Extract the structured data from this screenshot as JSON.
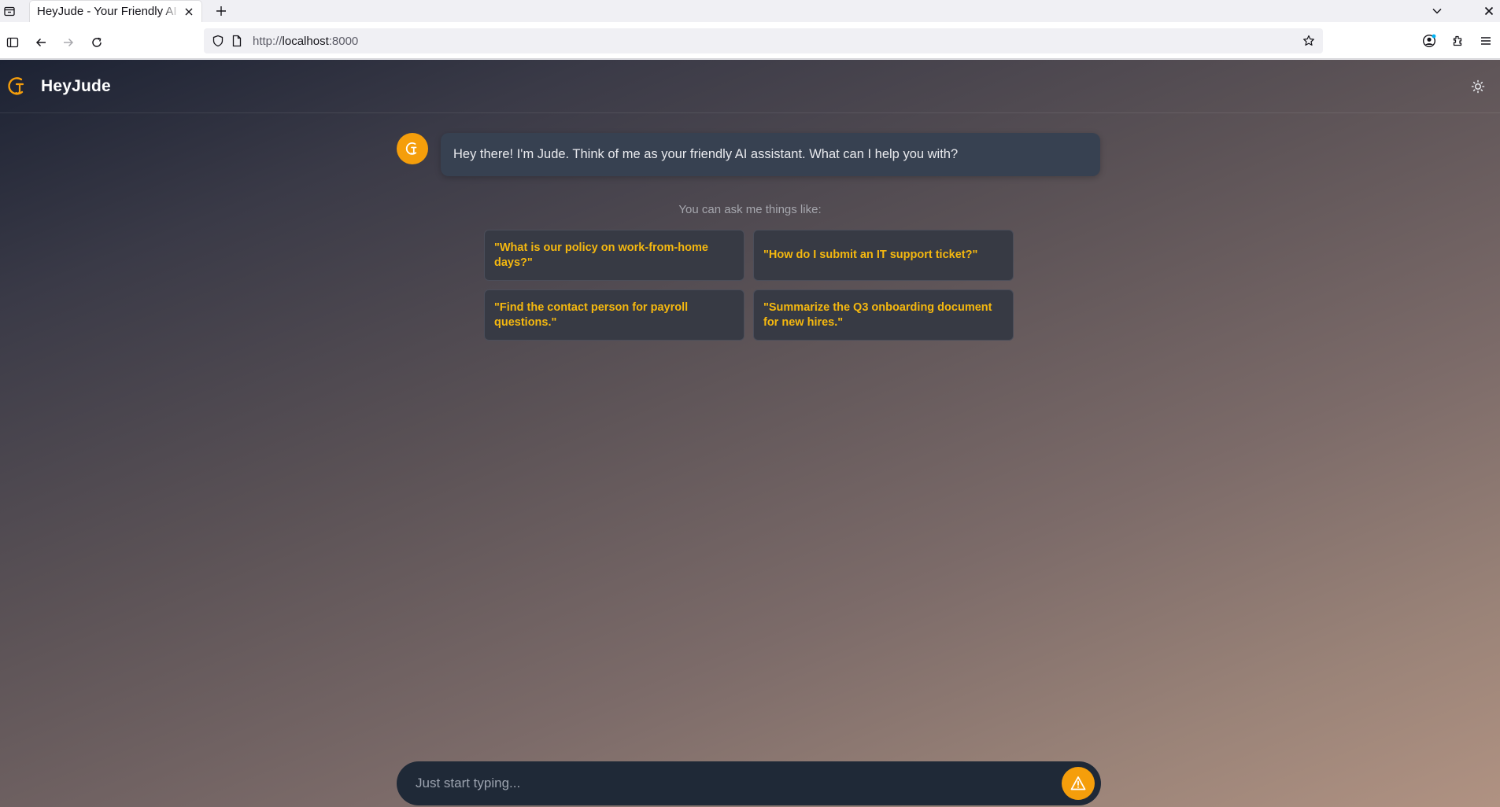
{
  "browser": {
    "tab_title": "HeyJude - Your Friendly AI",
    "url_prefix": "http://",
    "url_host": "localhost",
    "url_suffix": ":8000",
    "icons": {
      "tab_list": "tab-list-icon",
      "close_tab": "close-icon",
      "new_tab": "plus-icon",
      "list_all_tabs": "chevron-down-icon",
      "close_window": "close-icon",
      "sidebar": "sidebar-icon",
      "back": "back-arrow-icon",
      "forward": "forward-arrow-icon",
      "reload": "reload-icon",
      "shield": "shield-icon",
      "page": "page-icon",
      "bookmark": "star-icon",
      "account": "account-icon",
      "extensions": "puzzle-icon",
      "menu": "hamburger-menu-icon"
    }
  },
  "app": {
    "brand": "HeyJude",
    "accent_color": "#f59e0b",
    "welcome_message": "Hey there! I'm Jude. Think of me as your friendly AI assistant. What can I help you with?",
    "hint": "You can ask me things like:",
    "suggestions": [
      "\"What is our policy on work-from-home days?\"",
      "\"How do I submit an IT support ticket?\"",
      "\"Find the contact person for payroll questions.\"",
      "\"Summarize the Q3 onboarding document for new hires.\""
    ],
    "composer": {
      "placeholder": "Just start typing..."
    },
    "icons": {
      "logo": "jude-logo-icon",
      "theme_toggle": "sun-icon",
      "avatar": "jude-avatar-icon",
      "send": "send-icon"
    }
  }
}
